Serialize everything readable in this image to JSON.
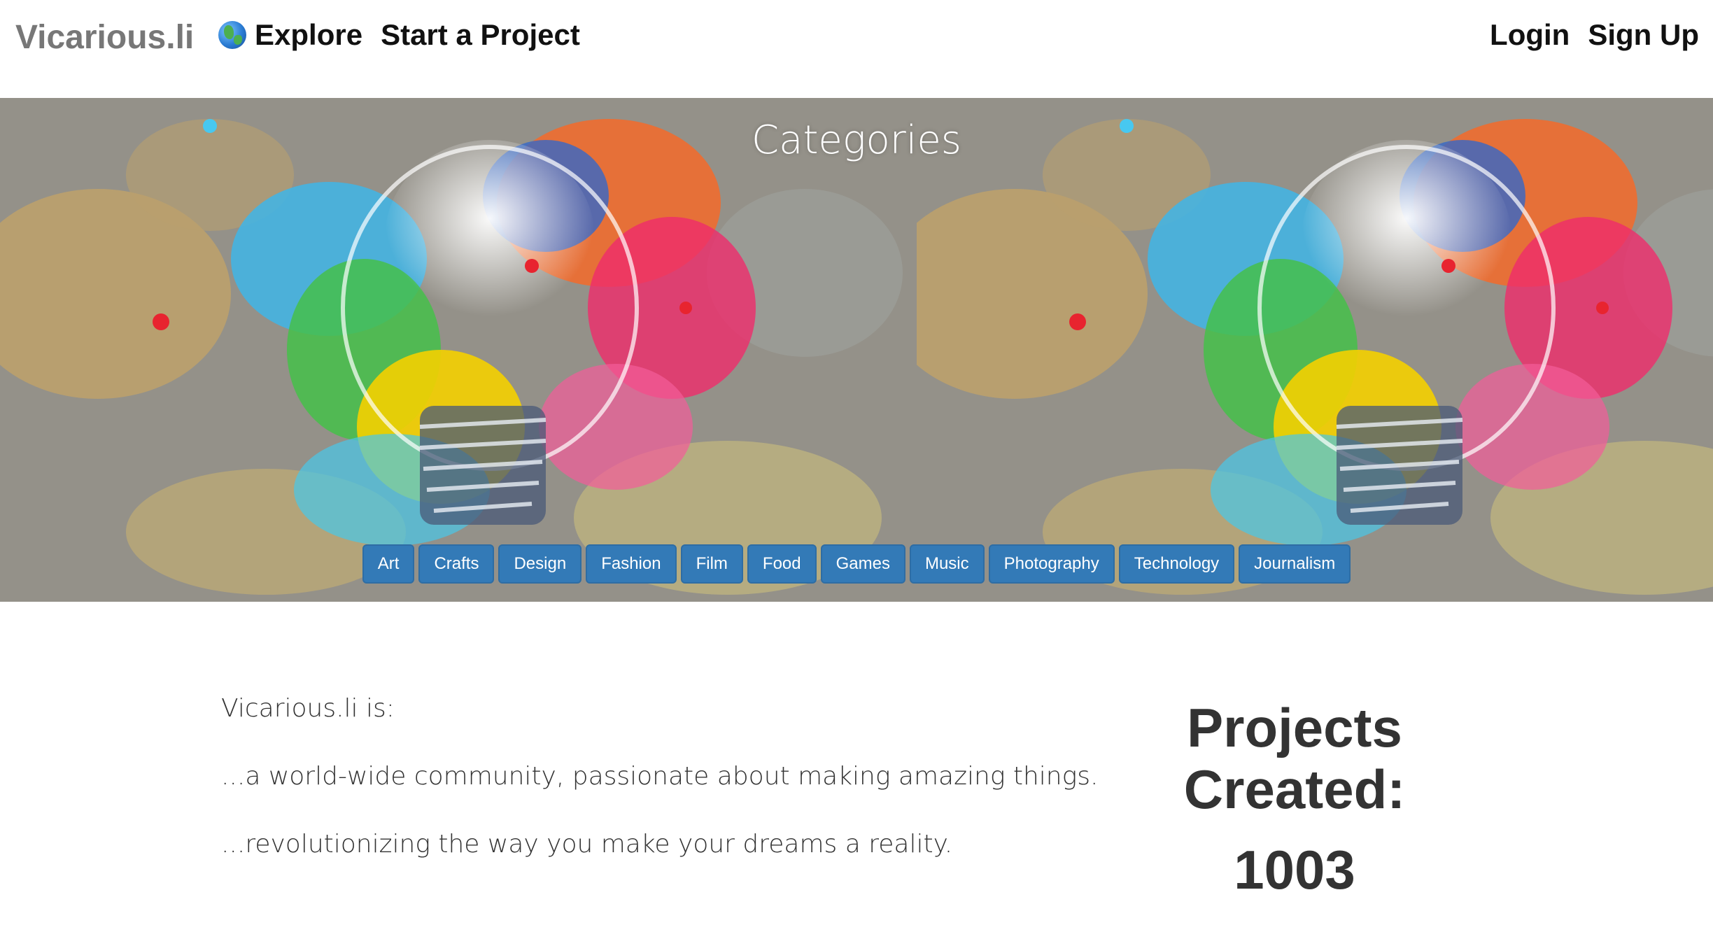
{
  "navbar": {
    "brand": "Vicarious.li",
    "explore_label": "Explore",
    "explore_icon": "globe-icon",
    "start_project_label": "Start a Project",
    "login_label": "Login",
    "signup_label": "Sign Up"
  },
  "hero": {
    "title": "Categories",
    "categories": [
      "Art",
      "Crafts",
      "Design",
      "Fashion",
      "Film",
      "Food",
      "Games",
      "Music",
      "Photography",
      "Technology",
      "Journalism"
    ],
    "button_color": "#337ab7"
  },
  "about": {
    "line1": "Vicarious.li is:",
    "line2": "...a world-wide community, passionate about making amazing things.",
    "line3": "...revolutionizing the way you make your dreams a reality."
  },
  "stats": {
    "label": "Projects Created:",
    "value": "1003"
  }
}
